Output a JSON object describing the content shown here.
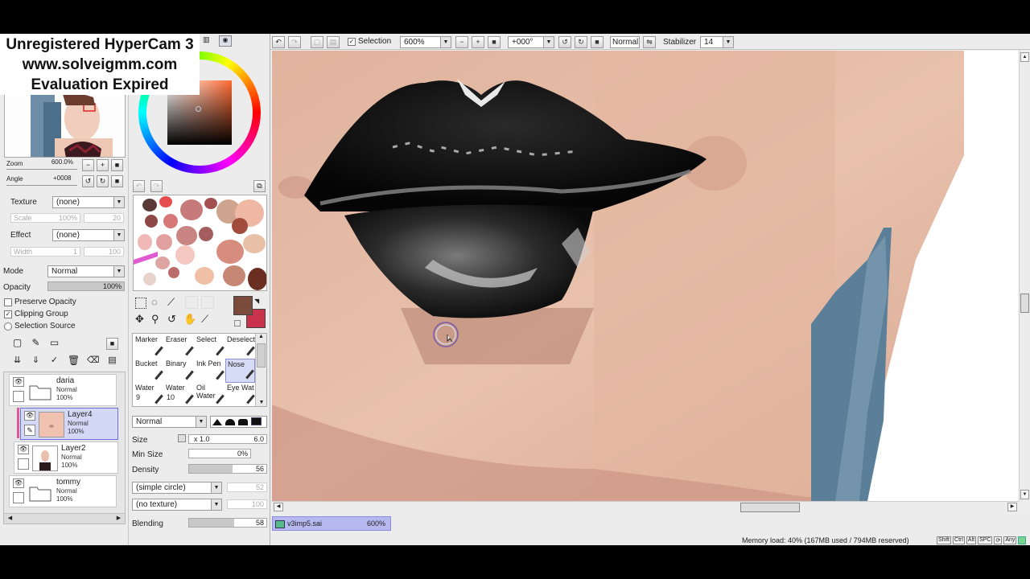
{
  "watermark": {
    "line1": "Unregistered HyperCam 3",
    "line2": "www.solveigmm.com",
    "line3": "Evaluation Expired"
  },
  "navigator": {
    "zoom_label": "Zoom",
    "zoom_value": "600.0%",
    "angle_label": "Angle",
    "angle_value": "+0008"
  },
  "brush_props": {
    "texture_label": "Texture",
    "texture_value": "(none)",
    "scale_label": "Scale",
    "scale_value": "100%",
    "scale_num": "20",
    "effect_label": "Effect",
    "effect_value": "(none)",
    "width_label": "Width",
    "width_value": "1",
    "width_num": "100"
  },
  "layer_props": {
    "mode_label": "Mode",
    "mode_value": "Normal",
    "opacity_label": "Opacity",
    "opacity_value": "100%",
    "preserve_opacity": "Preserve Opacity",
    "clipping_group": "Clipping Group",
    "selection_source": "Selection Source"
  },
  "layers": [
    {
      "name": "daria",
      "mode": "Normal",
      "opacity": "100%",
      "type": "folder"
    },
    {
      "name": "Layer4",
      "mode": "Normal",
      "opacity": "100%",
      "type": "layer",
      "selected": true
    },
    {
      "name": "Layer2",
      "mode": "Normal",
      "opacity": "100%",
      "type": "layer"
    },
    {
      "name": "tommy",
      "mode": "Normal",
      "opacity": "100%",
      "type": "folder"
    }
  ],
  "tools": [
    {
      "label": "Marker"
    },
    {
      "label": "Eraser"
    },
    {
      "label": "Select"
    },
    {
      "label": "Deselect"
    },
    {
      "label": "Bucket"
    },
    {
      "label": "Binary"
    },
    {
      "label": "Ink Pen"
    },
    {
      "label": "Nose"
    },
    {
      "label": "Water",
      "num": "9"
    },
    {
      "label": "Water",
      "num": "10"
    },
    {
      "label": "Oil Water"
    },
    {
      "label": "Eye Wat"
    }
  ],
  "tool_settings": {
    "blend_mode": "Normal",
    "size_label": "Size",
    "size_mult": "x 1.0",
    "size_value": "6.0",
    "min_size_label": "Min Size",
    "min_size_value": "0%",
    "density_label": "Density",
    "density_value": "56",
    "shape_value": "(simple circle)",
    "shape_num": "52",
    "texture_value": "(no texture)",
    "texture_num": "100",
    "blending_label": "Blending",
    "blending_value": "58"
  },
  "topbar": {
    "selection_label": "Selection",
    "zoom_value": "600%",
    "angle_value": "+000°",
    "mode_value": "Normal",
    "stabilizer_label": "Stabilizer",
    "stabilizer_value": "14"
  },
  "status": {
    "doc_name": "v3imp5.sai",
    "doc_zoom": "600%",
    "memory": "Memory load: 40% (167MB used / 794MB reserved)",
    "keys": [
      "Shift",
      "Ctrl",
      "Alt",
      "SPC"
    ],
    "key_extra": "Any"
  },
  "colors": {
    "primary": "#7a4a3a",
    "secondary": "#c8324a",
    "selection_highlight": "#d3d8f6",
    "lip_black": "#0c0c0c",
    "skin": "#e5b8a0",
    "shirt_blue": "#5b7f99"
  }
}
